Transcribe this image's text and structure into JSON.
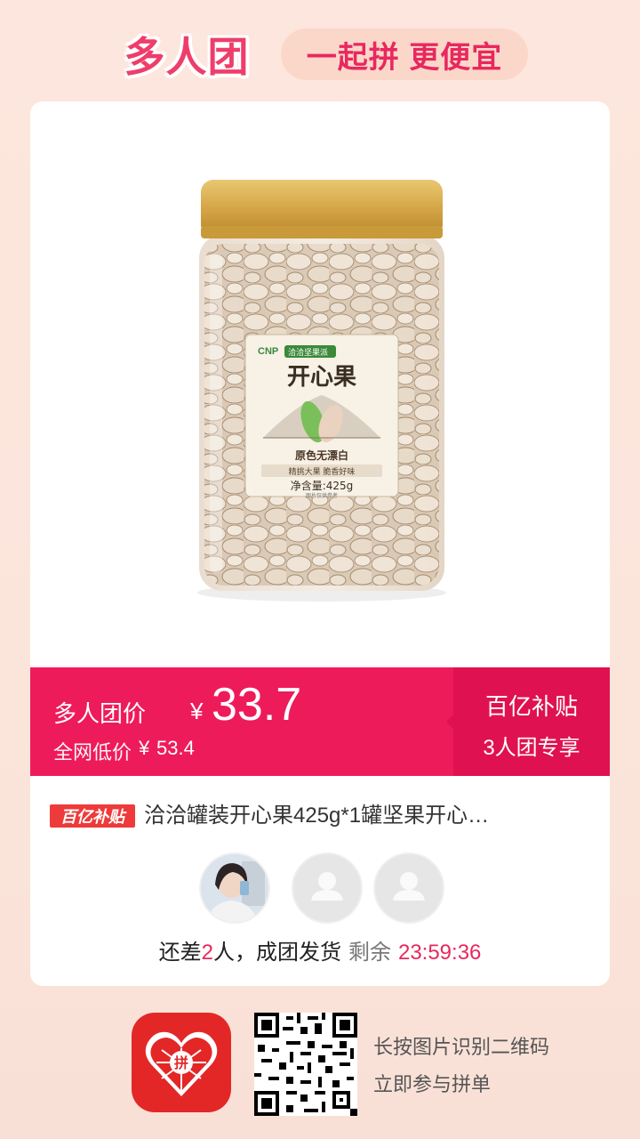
{
  "header": {
    "logo_text": "多人团",
    "slogan": "一起拼 更便宜"
  },
  "product": {
    "image_label_brand": "CNP",
    "image_label_brand_cn": "洽洽坚果派",
    "image_label_name": "开心果",
    "image_label_tag1": "原色无漂白",
    "image_label_tag2": "精挑大果  脆香好味",
    "image_label_net": "净含量:425g",
    "image_label_note": "图片仅供参考",
    "title": "洽洽罐装开心果425g*1罐坚果开心…",
    "tag": "百亿补贴"
  },
  "price": {
    "label": "多人团价",
    "currency": "¥",
    "value": "33.7",
    "orig_label": "全网低价",
    "orig_currency": "¥",
    "orig_value": "53.4"
  },
  "subsidy": {
    "title": "百亿补贴",
    "subtitle": "3人团专享"
  },
  "group": {
    "status_prefix": "还差",
    "missing_count": "2",
    "status_suffix": "人，成团发货",
    "remaining_label": "剩余",
    "timer": "23:59:36"
  },
  "footer": {
    "line1": "长按图片识别二维码",
    "line2": "立即参与拼单",
    "app_icon_text": "拼"
  },
  "colors": {
    "accent": "#ee1b5a",
    "accent_dark": "#e01150",
    "background": "#fbe5db",
    "tag_red": "#ee3a3a"
  },
  "icons": {
    "app": "pinduoduo-app-icon",
    "qr": "qr-code-icon",
    "avatar_placeholder": "user-placeholder-icon"
  }
}
